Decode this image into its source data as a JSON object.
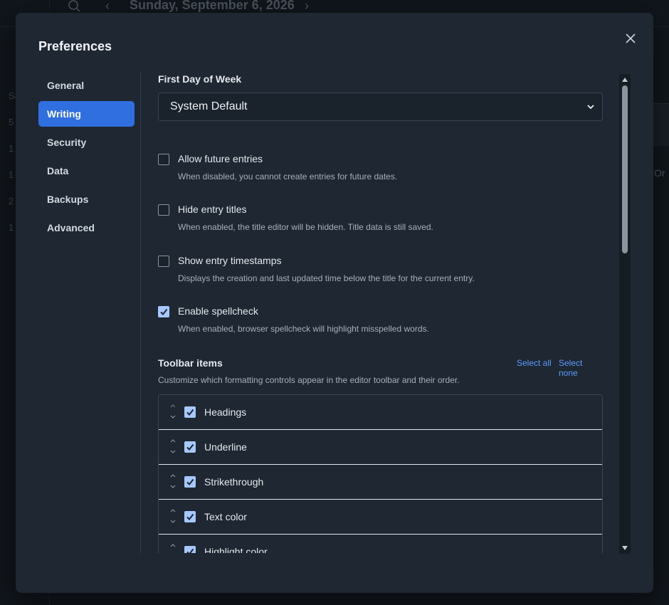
{
  "background": {
    "date_title": "Sunday, September 6, 2026",
    "side_items": [
      "Sa",
      "5",
      "1",
      "1",
      "2",
      "1"
    ],
    "right_text": "Or"
  },
  "modal": {
    "title": "Preferences",
    "close_icon": "close-icon"
  },
  "nav": {
    "items": [
      {
        "label": "General"
      },
      {
        "label": "Writing"
      },
      {
        "label": "Security"
      },
      {
        "label": "Data"
      },
      {
        "label": "Backups"
      },
      {
        "label": "Advanced"
      }
    ],
    "active": "Writing"
  },
  "writing": {
    "first_day_label": "First Day of Week",
    "first_day_value": "System Default",
    "options": [
      {
        "label": "Allow future entries",
        "desc": "When disabled, you cannot create entries for future dates.",
        "checked": false
      },
      {
        "label": "Hide entry titles",
        "desc": "When enabled, the title editor will be hidden. Title data is still saved.",
        "checked": false
      },
      {
        "label": "Show entry timestamps",
        "desc": "Displays the creation and last updated time below the title for the current entry.",
        "checked": false
      },
      {
        "label": "Enable spellcheck",
        "desc": "When enabled, browser spellcheck will highlight misspelled words.",
        "checked": true
      }
    ],
    "toolbar": {
      "title": "Toolbar items",
      "select_all": "Select all",
      "select_none": "Select none",
      "desc": "Customize which formatting controls appear in the editor toolbar and their order.",
      "items": [
        {
          "label": "Headings",
          "checked": true
        },
        {
          "label": "Underline",
          "checked": true
        },
        {
          "label": "Strikethrough",
          "checked": true
        },
        {
          "label": "Text color",
          "checked": true
        },
        {
          "label": "Highlight color",
          "checked": true
        }
      ]
    }
  },
  "colors": {
    "accent": "#2f6fe0",
    "checkbox_checked": "#a6c8ff",
    "link": "#5b9bff",
    "modal_bg": "#1e2732"
  }
}
